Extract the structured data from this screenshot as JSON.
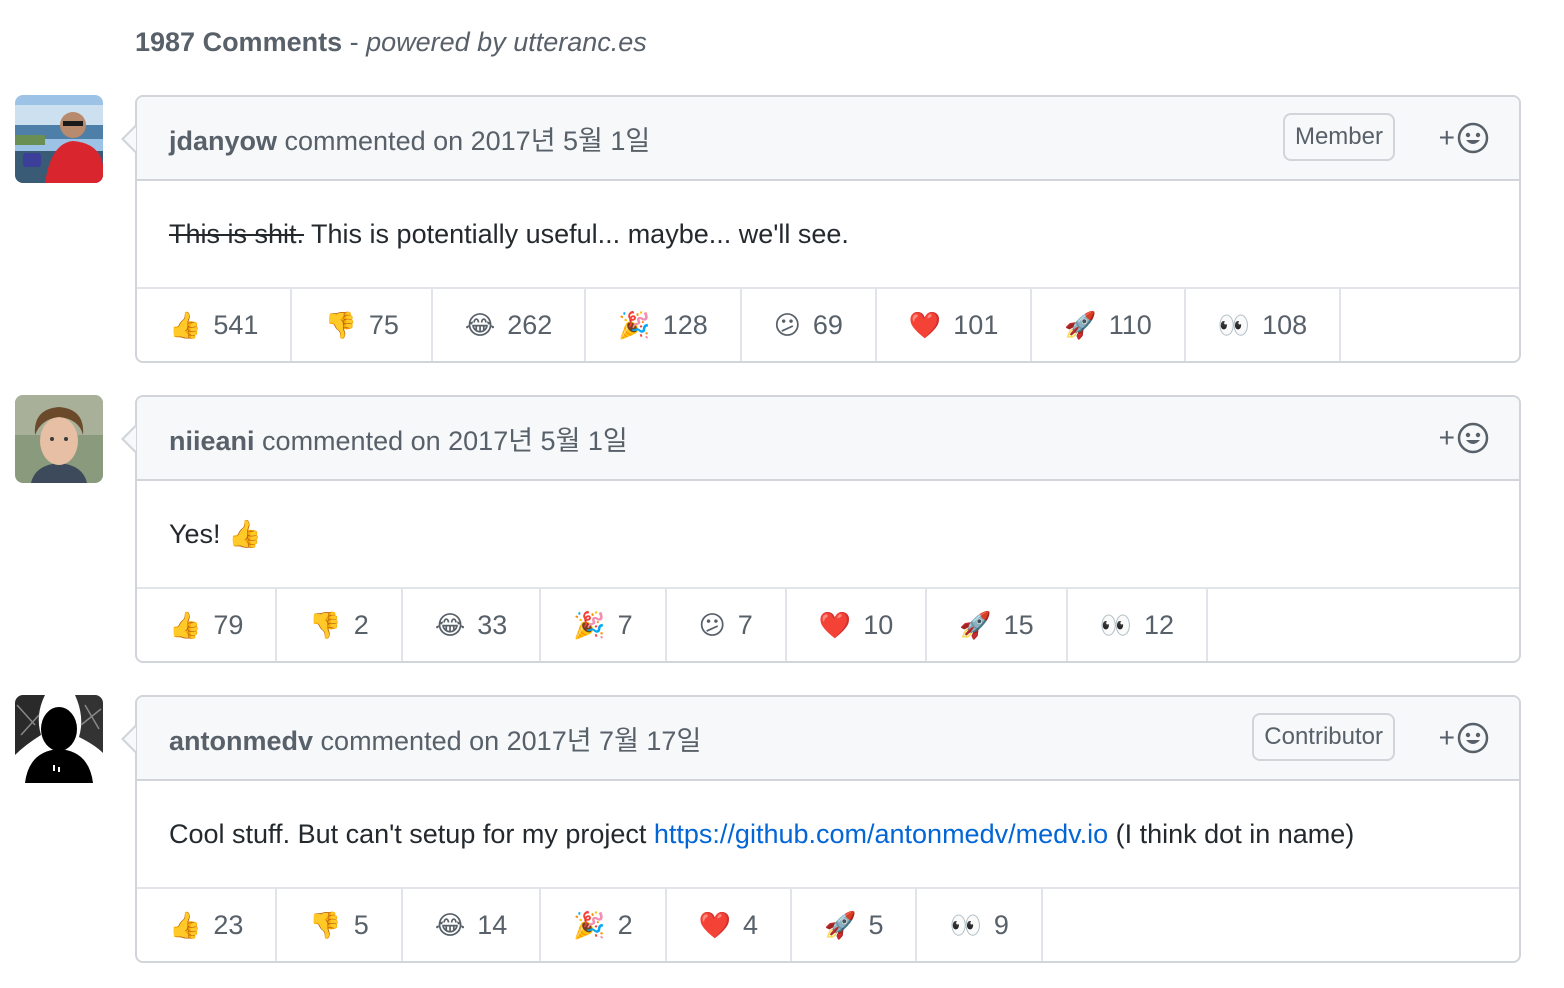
{
  "header": {
    "count": "1987 Comments",
    "powered": "powered by utteranc.es"
  },
  "comments": [
    {
      "author": "jdanyow",
      "meta": "commented on 2017년 5월 1일",
      "badge": "Member",
      "body": {
        "strike": "This is shit.",
        "text": " This is potentially useful... maybe... we'll see."
      },
      "reactions": [
        {
          "emoji": "👍",
          "count": "541"
        },
        {
          "emoji": "👎",
          "count": "75"
        },
        {
          "emoji": "😂",
          "count": "262"
        },
        {
          "emoji": "🎉",
          "count": "128"
        },
        {
          "emoji": "😕",
          "count": "69"
        },
        {
          "emoji": "❤️",
          "count": "101"
        },
        {
          "emoji": "🚀",
          "count": "110"
        },
        {
          "emoji": "👀",
          "count": "108"
        }
      ]
    },
    {
      "author": "niieani",
      "meta": "commented on 2017년 5월 1일",
      "body": {
        "text": "Yes! 👍"
      },
      "reactions": [
        {
          "emoji": "👍",
          "count": "79"
        },
        {
          "emoji": "👎",
          "count": "2"
        },
        {
          "emoji": "😂",
          "count": "33"
        },
        {
          "emoji": "🎉",
          "count": "7"
        },
        {
          "emoji": "😕",
          "count": "7"
        },
        {
          "emoji": "❤️",
          "count": "10"
        },
        {
          "emoji": "🚀",
          "count": "15"
        },
        {
          "emoji": "👀",
          "count": "12"
        }
      ]
    },
    {
      "author": "antonmedv",
      "meta": "commented on 2017년 7월 17일",
      "badge": "Contributor",
      "body": {
        "text": "Cool stuff. But can't setup for my project ",
        "link": "https://github.com/antonmedv/medv.io",
        "after": " (I think dot in name)"
      },
      "reactions": [
        {
          "emoji": "👍",
          "count": "23"
        },
        {
          "emoji": "👎",
          "count": "5"
        },
        {
          "emoji": "😂",
          "count": "14"
        },
        {
          "emoji": "🎉",
          "count": "2"
        },
        {
          "emoji": "❤️",
          "count": "4"
        },
        {
          "emoji": "🚀",
          "count": "5"
        },
        {
          "emoji": "👀",
          "count": "9"
        }
      ]
    }
  ],
  "add_reaction_label": "+",
  "icons": {
    "add_reaction": "smiley-icon",
    "caret": "speech-caret"
  },
  "colors": {
    "link": "#0366d6",
    "header_bg": "#f6f8fa",
    "border": "#d1d5da",
    "muted": "#586069"
  }
}
